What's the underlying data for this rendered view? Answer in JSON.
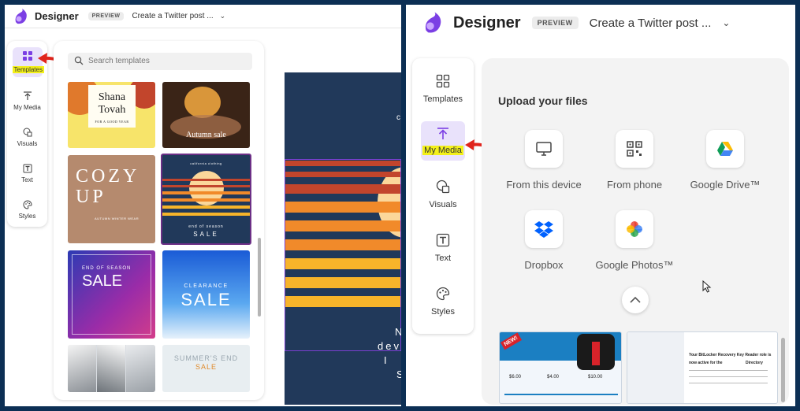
{
  "left": {
    "header": {
      "app_name": "Designer",
      "badge": "PREVIEW",
      "project": "Create a Twitter post ...",
      "chevron": "⌄"
    },
    "rail": [
      {
        "id": "templates",
        "label": "Templates",
        "icon": "templates-icon",
        "selected": true
      },
      {
        "id": "my-media",
        "label": "My Media",
        "icon": "upload-icon"
      },
      {
        "id": "visuals",
        "label": "Visuals",
        "icon": "image-icon"
      },
      {
        "id": "text",
        "label": "Text",
        "icon": "text-icon"
      },
      {
        "id": "styles",
        "label": "Styles",
        "icon": "palette-icon"
      }
    ],
    "search": {
      "placeholder": "Search templates"
    },
    "templates": {
      "shana": {
        "line1": "Shana",
        "line2": "Tovah",
        "sub": "FOR A GOOD YEAR"
      },
      "autumn": {
        "title": "Autumn sale"
      },
      "cozy": {
        "line1": "COZY",
        "line2": "UP",
        "sub": "AUTUMN WINTER WEAR"
      },
      "sunset": {
        "brand": "california clothing",
        "line1": "end of season",
        "line2": "SALE"
      },
      "season": {
        "top": "END OF SEASON",
        "title": "SALE"
      },
      "clearance": {
        "line1": "CLEARANCE",
        "line2": "SALE"
      },
      "summer": {
        "line1": "SUMMER'S END",
        "line2": "SALE"
      }
    },
    "canvas": {
      "t1": "c",
      "t2": "N",
      "t3": "dev",
      "t4": "I",
      "t5": "S"
    }
  },
  "right": {
    "header": {
      "app_name": "Designer",
      "badge": "PREVIEW",
      "project": "Create a Twitter post ...",
      "chevron": "⌄"
    },
    "rail": [
      {
        "id": "templates",
        "label": "Templates",
        "icon": "templates-icon"
      },
      {
        "id": "my-media",
        "label": "My Media",
        "icon": "upload-icon",
        "selected": true
      },
      {
        "id": "visuals",
        "label": "Visuals",
        "icon": "image-icon"
      },
      {
        "id": "text",
        "label": "Text",
        "icon": "text-icon"
      },
      {
        "id": "styles",
        "label": "Styles",
        "icon": "palette-icon"
      }
    ],
    "upload": {
      "title": "Upload your files",
      "sources": [
        {
          "label": "From this device",
          "icon": "monitor-icon"
        },
        {
          "label": "From phone",
          "icon": "qr-code-icon"
        },
        {
          "label": "Google Drive™",
          "icon": "google-drive-icon"
        },
        {
          "label": "Dropbox",
          "icon": "dropbox-icon"
        },
        {
          "label": "Google Photos™",
          "icon": "google-photos-icon"
        }
      ],
      "collapse_icon": "chevron-up-icon"
    },
    "media": [
      {
        "kind": "pricing-image",
        "badge": "NEW!",
        "prices": [
          "$6.00",
          "$4.00",
          "$10.00"
        ]
      },
      {
        "kind": "email-screenshot",
        "line1": "Your BitLocker Recovery Key Reader role is",
        "line2": "now active for the",
        "line3": "Directory"
      }
    ]
  },
  "colors": {
    "highlight": "#f3f01a",
    "arrow": "#e0241c",
    "accent": "#7b3fe4",
    "background": "#0c2f54"
  }
}
